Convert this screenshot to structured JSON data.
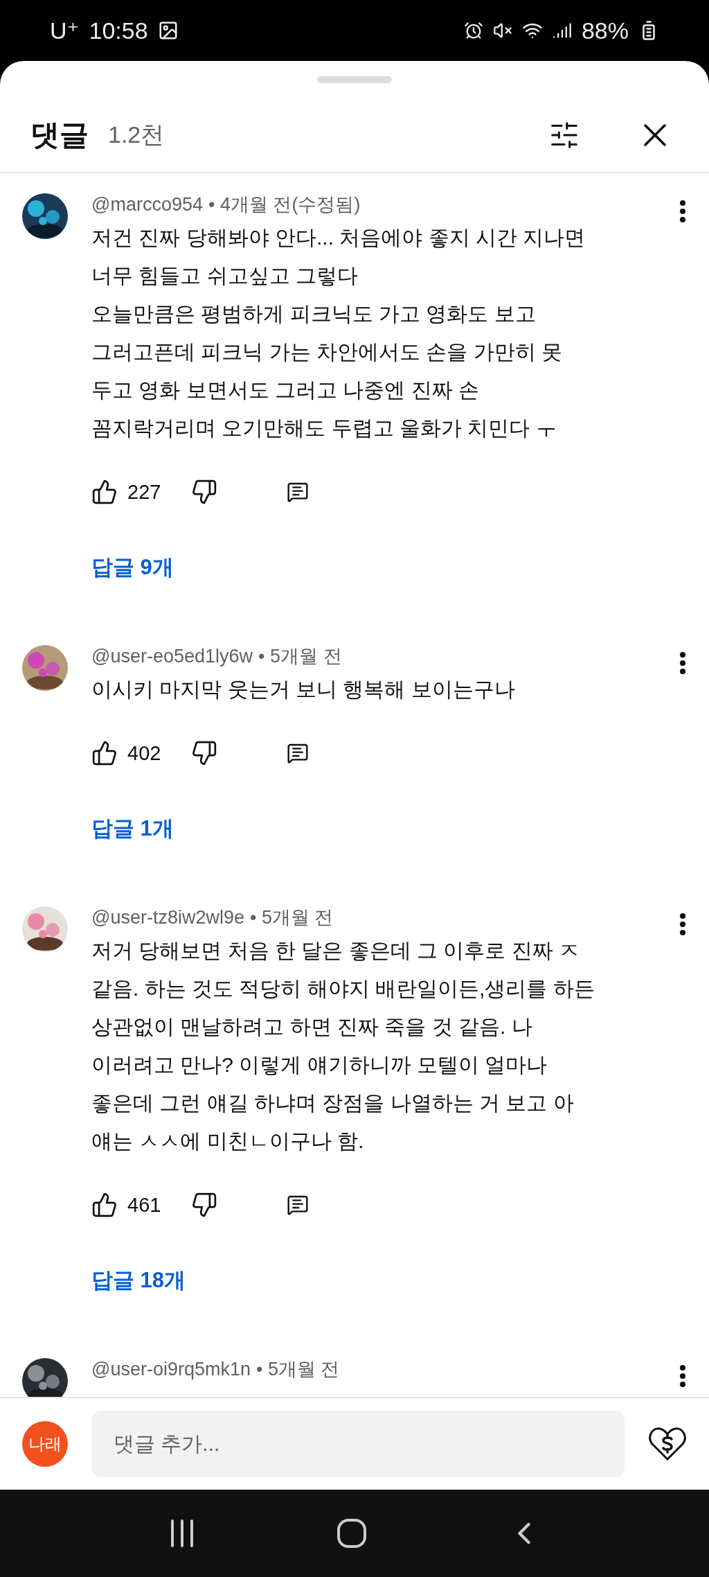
{
  "status_bar": {
    "carrier": "U⁺",
    "time": "10:58",
    "battery": "88%"
  },
  "header": {
    "title": "댓글",
    "count": "1.2천"
  },
  "comments": [
    {
      "author": "@marcco954",
      "meta": "• 4개월 전(수정됨)",
      "lines": [
        "저건 진짜 당해봐야 안다... 처음에야 좋지 시간 지나면",
        "너무 힘들고 쉬고싶고 그렇다",
        "오늘만큼은 평범하게 피크닉도 가고 영화도 보고",
        "그러고픈데 피크닉 가는 차안에서도 손을 가만히 못",
        "두고 영화 보면서도 그러고 나중엔 진짜 손",
        "꼼지락거리며 오기만해도 두렵고 울화가 치민다 ㅜ"
      ],
      "likes": "227",
      "replies": "답글 9개"
    },
    {
      "author": "@user-eo5ed1ly6w",
      "meta": "• 5개월 전",
      "lines": [
        "이시키 마지막 웃는거 보니 행복해 보이는구나"
      ],
      "likes": "402",
      "replies": "답글 1개"
    },
    {
      "author": "@user-tz8iw2wl9e",
      "meta": "• 5개월 전",
      "lines": [
        "저거 당해보면 처음 한 달은 좋은데 그 이후로 진짜 ㅈ",
        "같음. 하는 것도 적당히 해야지 배란일이든,생리를 하든",
        "상관없이 맨날하려고 하면 진짜 죽을 것 같음. 나",
        "이러려고 만나? 이렇게 얘기하니까 모텔이 얼마나",
        "좋은데 그런 얘길 하냐며 장점을 나열하는 거 보고 아",
        "얘는 ㅅㅅ에 미친ㄴ이구나 함."
      ],
      "likes": "461",
      "replies": "답글 18개"
    },
    {
      "author": "@user-oi9rq5mk1n",
      "meta": "• 5개월 전"
    }
  ],
  "composer": {
    "avatar_text": "나래",
    "placeholder": "댓글 추가..."
  }
}
